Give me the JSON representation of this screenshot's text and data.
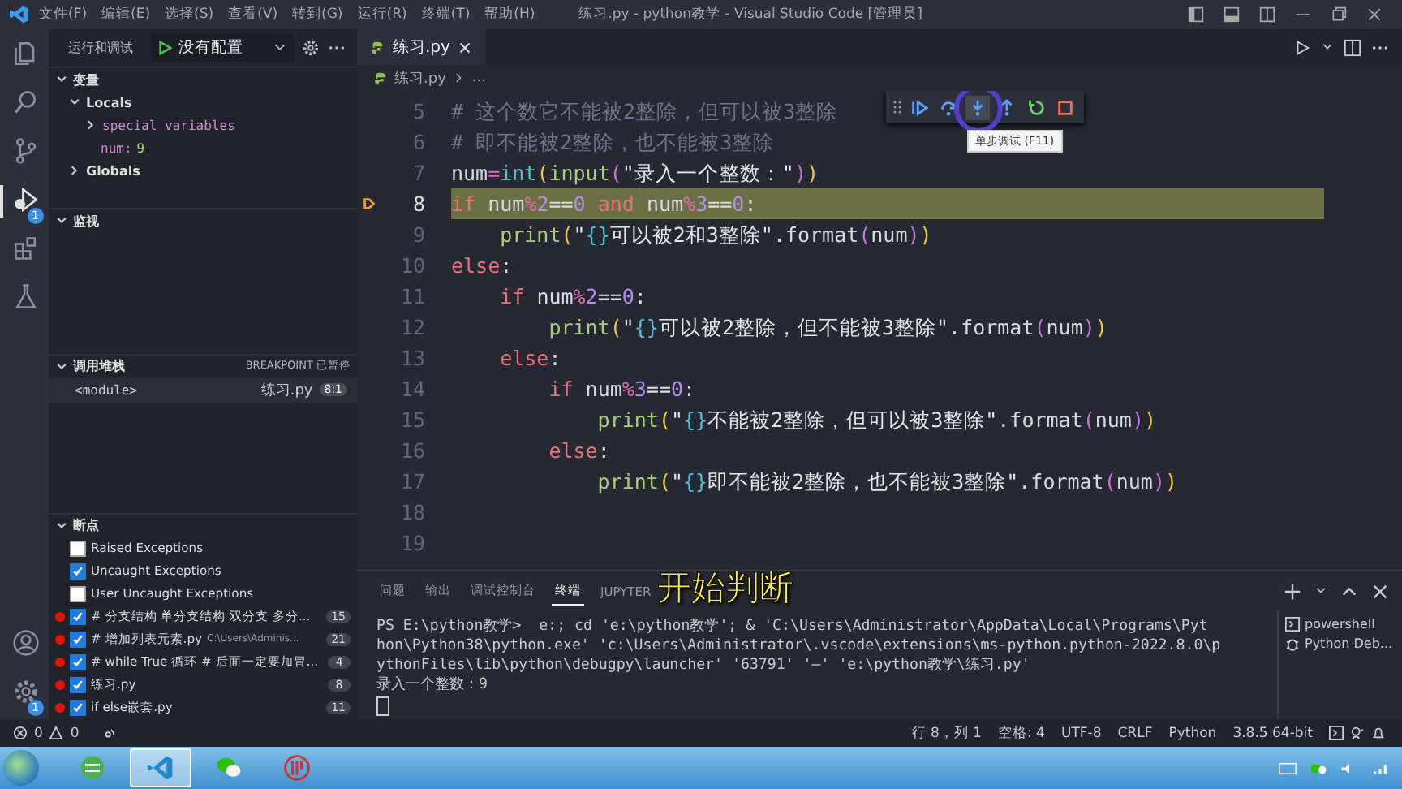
{
  "window": {
    "title": "练习.py - python教学 - Visual Studio Code [管理员]",
    "menu": [
      "文件(F)",
      "编辑(E)",
      "选择(S)",
      "查看(V)",
      "转到(G)",
      "运行(R)",
      "终端(T)",
      "帮助(H)"
    ]
  },
  "activity_bar": {
    "items": [
      {
        "selected": false
      },
      {
        "selected": false
      },
      {
        "selected": false
      },
      {
        "selected": true,
        "badge": "1"
      },
      {
        "selected": false
      },
      {
        "selected": false
      }
    ],
    "bottom": [
      {
        "selected": false
      },
      {
        "selected": false,
        "badge": "1"
      }
    ]
  },
  "sidebar": {
    "title": "运行和调试",
    "config": "没有配置",
    "variables": {
      "title": "变量",
      "expanded": true,
      "tree": [
        {
          "label": "Locals",
          "expanded": true,
          "children": [
            {
              "kind": "group",
              "label": "special variables",
              "expanded": false
            },
            {
              "kind": "var",
              "name": "num:",
              "value": "9"
            }
          ]
        },
        {
          "label": "Globals",
          "expanded": false
        }
      ]
    },
    "watch": {
      "title": "监视",
      "expanded": true
    },
    "call_stack": {
      "title": "调用堆栈",
      "expanded": true,
      "status": "BREAKPOINT 已暂停",
      "frames": [
        {
          "name": "<module>",
          "file": "练习.py",
          "position": "8:1"
        }
      ]
    },
    "breakpoints": {
      "title": "断点",
      "expanded": true,
      "items": [
        {
          "kind": "exception",
          "label": "Raised Exceptions",
          "checked": false
        },
        {
          "kind": "exception",
          "label": "Uncaught Exceptions",
          "checked": true
        },
        {
          "kind": "exception",
          "label": "User Uncaught Exceptions",
          "checked": false
        },
        {
          "kind": "file",
          "label": "# 分支结构 单分支结构 双分支 多分...",
          "line": "15",
          "checked": true
        },
        {
          "kind": "file",
          "label": "# 增加列表元素.py",
          "path": "C:\\Users\\Adminis...",
          "line": "21",
          "checked": true
        },
        {
          "kind": "file",
          "label": "# while True 循环 # 后面一定要加冒...",
          "line": "4",
          "checked": true
        },
        {
          "kind": "file",
          "label": "练习.py",
          "line": "8",
          "checked": true
        },
        {
          "kind": "file",
          "label": "if else嵌套.py",
          "line": "11",
          "checked": true
        }
      ]
    }
  },
  "editor": {
    "tabs": [
      {
        "label": "练习.py",
        "selected": true
      }
    ],
    "breadcrumb": [
      "练习.py",
      "..."
    ],
    "debug_toolbar": {
      "buttons": [
        {
          "kind": "continue",
          "hovered": false
        },
        {
          "kind": "step-over",
          "hovered": false
        },
        {
          "kind": "step-into",
          "hovered": true
        },
        {
          "kind": "step-out",
          "hovered": false
        },
        {
          "kind": "restart",
          "hovered": false
        },
        {
          "kind": "stop",
          "hovered": false
        }
      ],
      "tooltip": "单步调试 (F11)"
    },
    "lines": [
      {
        "number": "5",
        "current": false,
        "tokens": [
          {
            "kind": "comment",
            "text": "# 这个数它不能被2整除，但可以被3整除"
          }
        ]
      },
      {
        "number": "6",
        "current": false,
        "tokens": [
          {
            "kind": "comment",
            "text": "# 即不能被2整除，也不能被3整除"
          }
        ]
      },
      {
        "number": "7",
        "current": false,
        "tokens": [
          {
            "kind": "name",
            "text": "num"
          },
          {
            "kind": "operator",
            "text": "="
          },
          {
            "kind": "builtin",
            "text": "int"
          },
          {
            "kind": "paren",
            "text": "("
          },
          {
            "kind": "function",
            "text": "input"
          },
          {
            "kind": "paren2",
            "text": "("
          },
          {
            "kind": "string",
            "text": "\"录入一个整数：\""
          },
          {
            "kind": "paren2",
            "text": ")"
          },
          {
            "kind": "paren",
            "text": ")"
          }
        ]
      },
      {
        "number": "8",
        "current": true,
        "tokens": [
          {
            "kind": "keyword",
            "text": "if "
          },
          {
            "kind": "name",
            "text": "num"
          },
          {
            "kind": "operator",
            "text": "%"
          },
          {
            "kind": "number",
            "text": "2"
          },
          {
            "kind": "name",
            "text": "=="
          },
          {
            "kind": "number",
            "text": "0"
          },
          {
            "kind": "keyword",
            "text": " and "
          },
          {
            "kind": "name",
            "text": "num"
          },
          {
            "kind": "operator",
            "text": "%"
          },
          {
            "kind": "number",
            "text": "3"
          },
          {
            "kind": "name",
            "text": "=="
          },
          {
            "kind": "number",
            "text": "0"
          },
          {
            "kind": "name",
            "text": ":"
          }
        ]
      },
      {
        "number": "9",
        "current": false,
        "tokens": [
          {
            "kind": "function",
            "text": "    print"
          },
          {
            "kind": "paren",
            "text": "("
          },
          {
            "kind": "string",
            "text": "\""
          },
          {
            "kind": "brace",
            "text": "{}"
          },
          {
            "kind": "string",
            "text": "可以被2和3整除\""
          },
          {
            "kind": "name",
            "text": ".format"
          },
          {
            "kind": "paren2",
            "text": "("
          },
          {
            "kind": "name",
            "text": "num"
          },
          {
            "kind": "paren2",
            "text": ")"
          },
          {
            "kind": "paren",
            "text": ")"
          }
        ]
      },
      {
        "number": "10",
        "current": false,
        "tokens": [
          {
            "kind": "keyword",
            "text": "else"
          },
          {
            "kind": "name",
            "text": ":"
          }
        ]
      },
      {
        "number": "11",
        "current": false,
        "tokens": [
          {
            "kind": "keyword",
            "text": "    if "
          },
          {
            "kind": "name",
            "text": "num"
          },
          {
            "kind": "operator",
            "text": "%"
          },
          {
            "kind": "number",
            "text": "2"
          },
          {
            "kind": "name",
            "text": "=="
          },
          {
            "kind": "number",
            "text": "0"
          },
          {
            "kind": "name",
            "text": ":"
          }
        ]
      },
      {
        "number": "12",
        "current": false,
        "tokens": [
          {
            "kind": "function",
            "text": "        print"
          },
          {
            "kind": "paren",
            "text": "("
          },
          {
            "kind": "string",
            "text": "\""
          },
          {
            "kind": "brace",
            "text": "{}"
          },
          {
            "kind": "string",
            "text": "可以被2整除，但不能被3整除\""
          },
          {
            "kind": "name",
            "text": ".format"
          },
          {
            "kind": "paren2",
            "text": "("
          },
          {
            "kind": "name",
            "text": "num"
          },
          {
            "kind": "paren2",
            "text": ")"
          },
          {
            "kind": "paren",
            "text": ")"
          }
        ]
      },
      {
        "number": "13",
        "current": false,
        "tokens": [
          {
            "kind": "keyword",
            "text": "    else"
          },
          {
            "kind": "name",
            "text": ":"
          }
        ]
      },
      {
        "number": "14",
        "current": false,
        "tokens": [
          {
            "kind": "keyword",
            "text": "        if "
          },
          {
            "kind": "name",
            "text": "num"
          },
          {
            "kind": "operator",
            "text": "%"
          },
          {
            "kind": "number",
            "text": "3"
          },
          {
            "kind": "name",
            "text": "=="
          },
          {
            "kind": "number",
            "text": "0"
          },
          {
            "kind": "name",
            "text": ":"
          }
        ]
      },
      {
        "number": "15",
        "current": false,
        "tokens": [
          {
            "kind": "function",
            "text": "            print"
          },
          {
            "kind": "paren",
            "text": "("
          },
          {
            "kind": "string",
            "text": "\""
          },
          {
            "kind": "brace",
            "text": "{}"
          },
          {
            "kind": "string",
            "text": "不能被2整除，但可以被3整除\""
          },
          {
            "kind": "name",
            "text": ".format"
          },
          {
            "kind": "paren2",
            "text": "("
          },
          {
            "kind": "name",
            "text": "num"
          },
          {
            "kind": "paren2",
            "text": ")"
          },
          {
            "kind": "paren",
            "text": ")"
          }
        ]
      },
      {
        "number": "16",
        "current": false,
        "tokens": [
          {
            "kind": "keyword",
            "text": "        else"
          },
          {
            "kind": "name",
            "text": ":"
          }
        ]
      },
      {
        "number": "17",
        "current": false,
        "tokens": [
          {
            "kind": "function",
            "text": "            print"
          },
          {
            "kind": "paren",
            "text": "("
          },
          {
            "kind": "string",
            "text": "\""
          },
          {
            "kind": "brace",
            "text": "{}"
          },
          {
            "kind": "string",
            "text": "即不能被2整除，也不能被3整除\""
          },
          {
            "kind": "name",
            "text": ".format"
          },
          {
            "kind": "paren2",
            "text": "("
          },
          {
            "kind": "name",
            "text": "num"
          },
          {
            "kind": "paren2",
            "text": ")"
          },
          {
            "kind": "paren",
            "text": ")"
          }
        ]
      },
      {
        "number": "18",
        "current": false
      },
      {
        "number": "19",
        "current": false
      }
    ]
  },
  "panel": {
    "tabs": [
      {
        "label": "问题",
        "selected": false
      },
      {
        "label": "输出",
        "selected": false
      },
      {
        "label": "调试控制台",
        "selected": false
      },
      {
        "label": "终端",
        "selected": true
      },
      {
        "label": "JUPYTER",
        "selected": false
      }
    ],
    "subtitle": "开始判断",
    "terminal": [
      "PS E:\\python教学>  e:; cd 'e:\\python教学'; & 'C:\\Users\\Administrator\\AppData\\Local\\Programs\\Pyt",
      "hon\\Python38\\python.exe' 'c:\\Users\\Administrator\\.vscode\\extensions\\ms-python.python-2022.8.0\\p",
      "ythonFiles\\lib\\python\\debugpy\\launcher' '63791' '—' 'e:\\python教学\\练习.py'",
      "录入一个整数：9"
    ],
    "sessions": [
      {
        "kind": "terminal",
        "label": "powershell"
      },
      {
        "kind": "debug",
        "label": "Python Deb..."
      }
    ]
  },
  "status_bar": {
    "errors": "0",
    "warnings": "0",
    "items": [
      "行 8，列 1",
      "空格: 4",
      "UTF-8",
      "CRLF",
      "Python",
      "3.8.5 64-bit"
    ]
  },
  "taskbar": {
    "apps": [
      {
        "kind": "browser",
        "selected": false
      },
      {
        "kind": "vscode",
        "selected": true
      },
      {
        "kind": "wechat",
        "selected": false
      },
      {
        "kind": "red-logo",
        "selected": false
      }
    ]
  }
}
